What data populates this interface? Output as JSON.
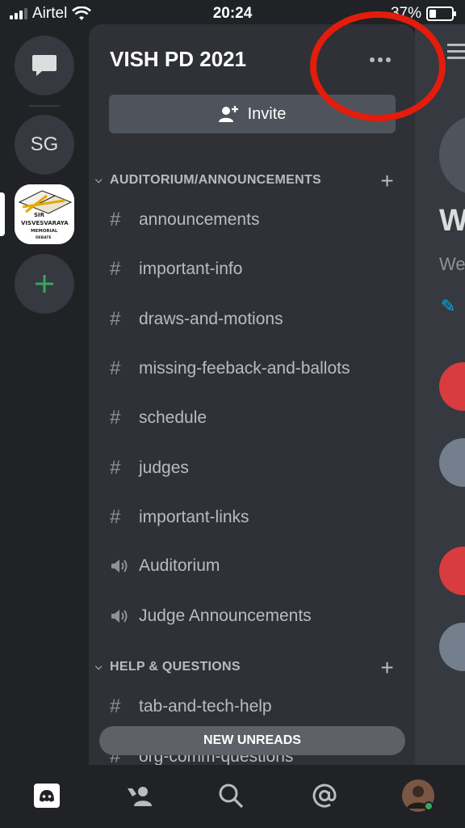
{
  "status": {
    "carrier": "Airtel",
    "time": "20:24",
    "battery": "37%",
    "battery_level": 0.37
  },
  "guilds": {
    "sg_initials": "SG",
    "vish_logo_text": [
      "SIR",
      "VISVESVARAYA",
      "MEMORIAL",
      "DEBATE"
    ]
  },
  "server": {
    "title": "VISH PD 2021",
    "invite_label": "Invite"
  },
  "categories": [
    {
      "name": "AUDITORIUM/ANNOUNCEMENTS",
      "channels": [
        {
          "name": "announcements",
          "type": "text"
        },
        {
          "name": "important-info",
          "type": "text"
        },
        {
          "name": "draws-and-motions",
          "type": "text"
        },
        {
          "name": "missing-feeback-and-ballots",
          "type": "text"
        },
        {
          "name": "schedule",
          "type": "text"
        },
        {
          "name": "judges",
          "type": "text"
        },
        {
          "name": "important-links",
          "type": "text"
        },
        {
          "name": "Auditorium",
          "type": "voice"
        },
        {
          "name": "Judge Announcements",
          "type": "voice"
        }
      ]
    },
    {
      "name": "HELP & QUESTIONS",
      "channels": [
        {
          "name": "tab-and-tech-help",
          "type": "text"
        },
        {
          "name": "org-comm-questions",
          "type": "text"
        }
      ]
    }
  ],
  "new_unreads": "NEW UNREADS",
  "chat_preview": {
    "heading_partial": "W",
    "subtitle_partial": "We"
  },
  "colors": {
    "annotation_ring": "#e31c0c",
    "online": "#3ba55c",
    "blurple": "#5865f2"
  }
}
